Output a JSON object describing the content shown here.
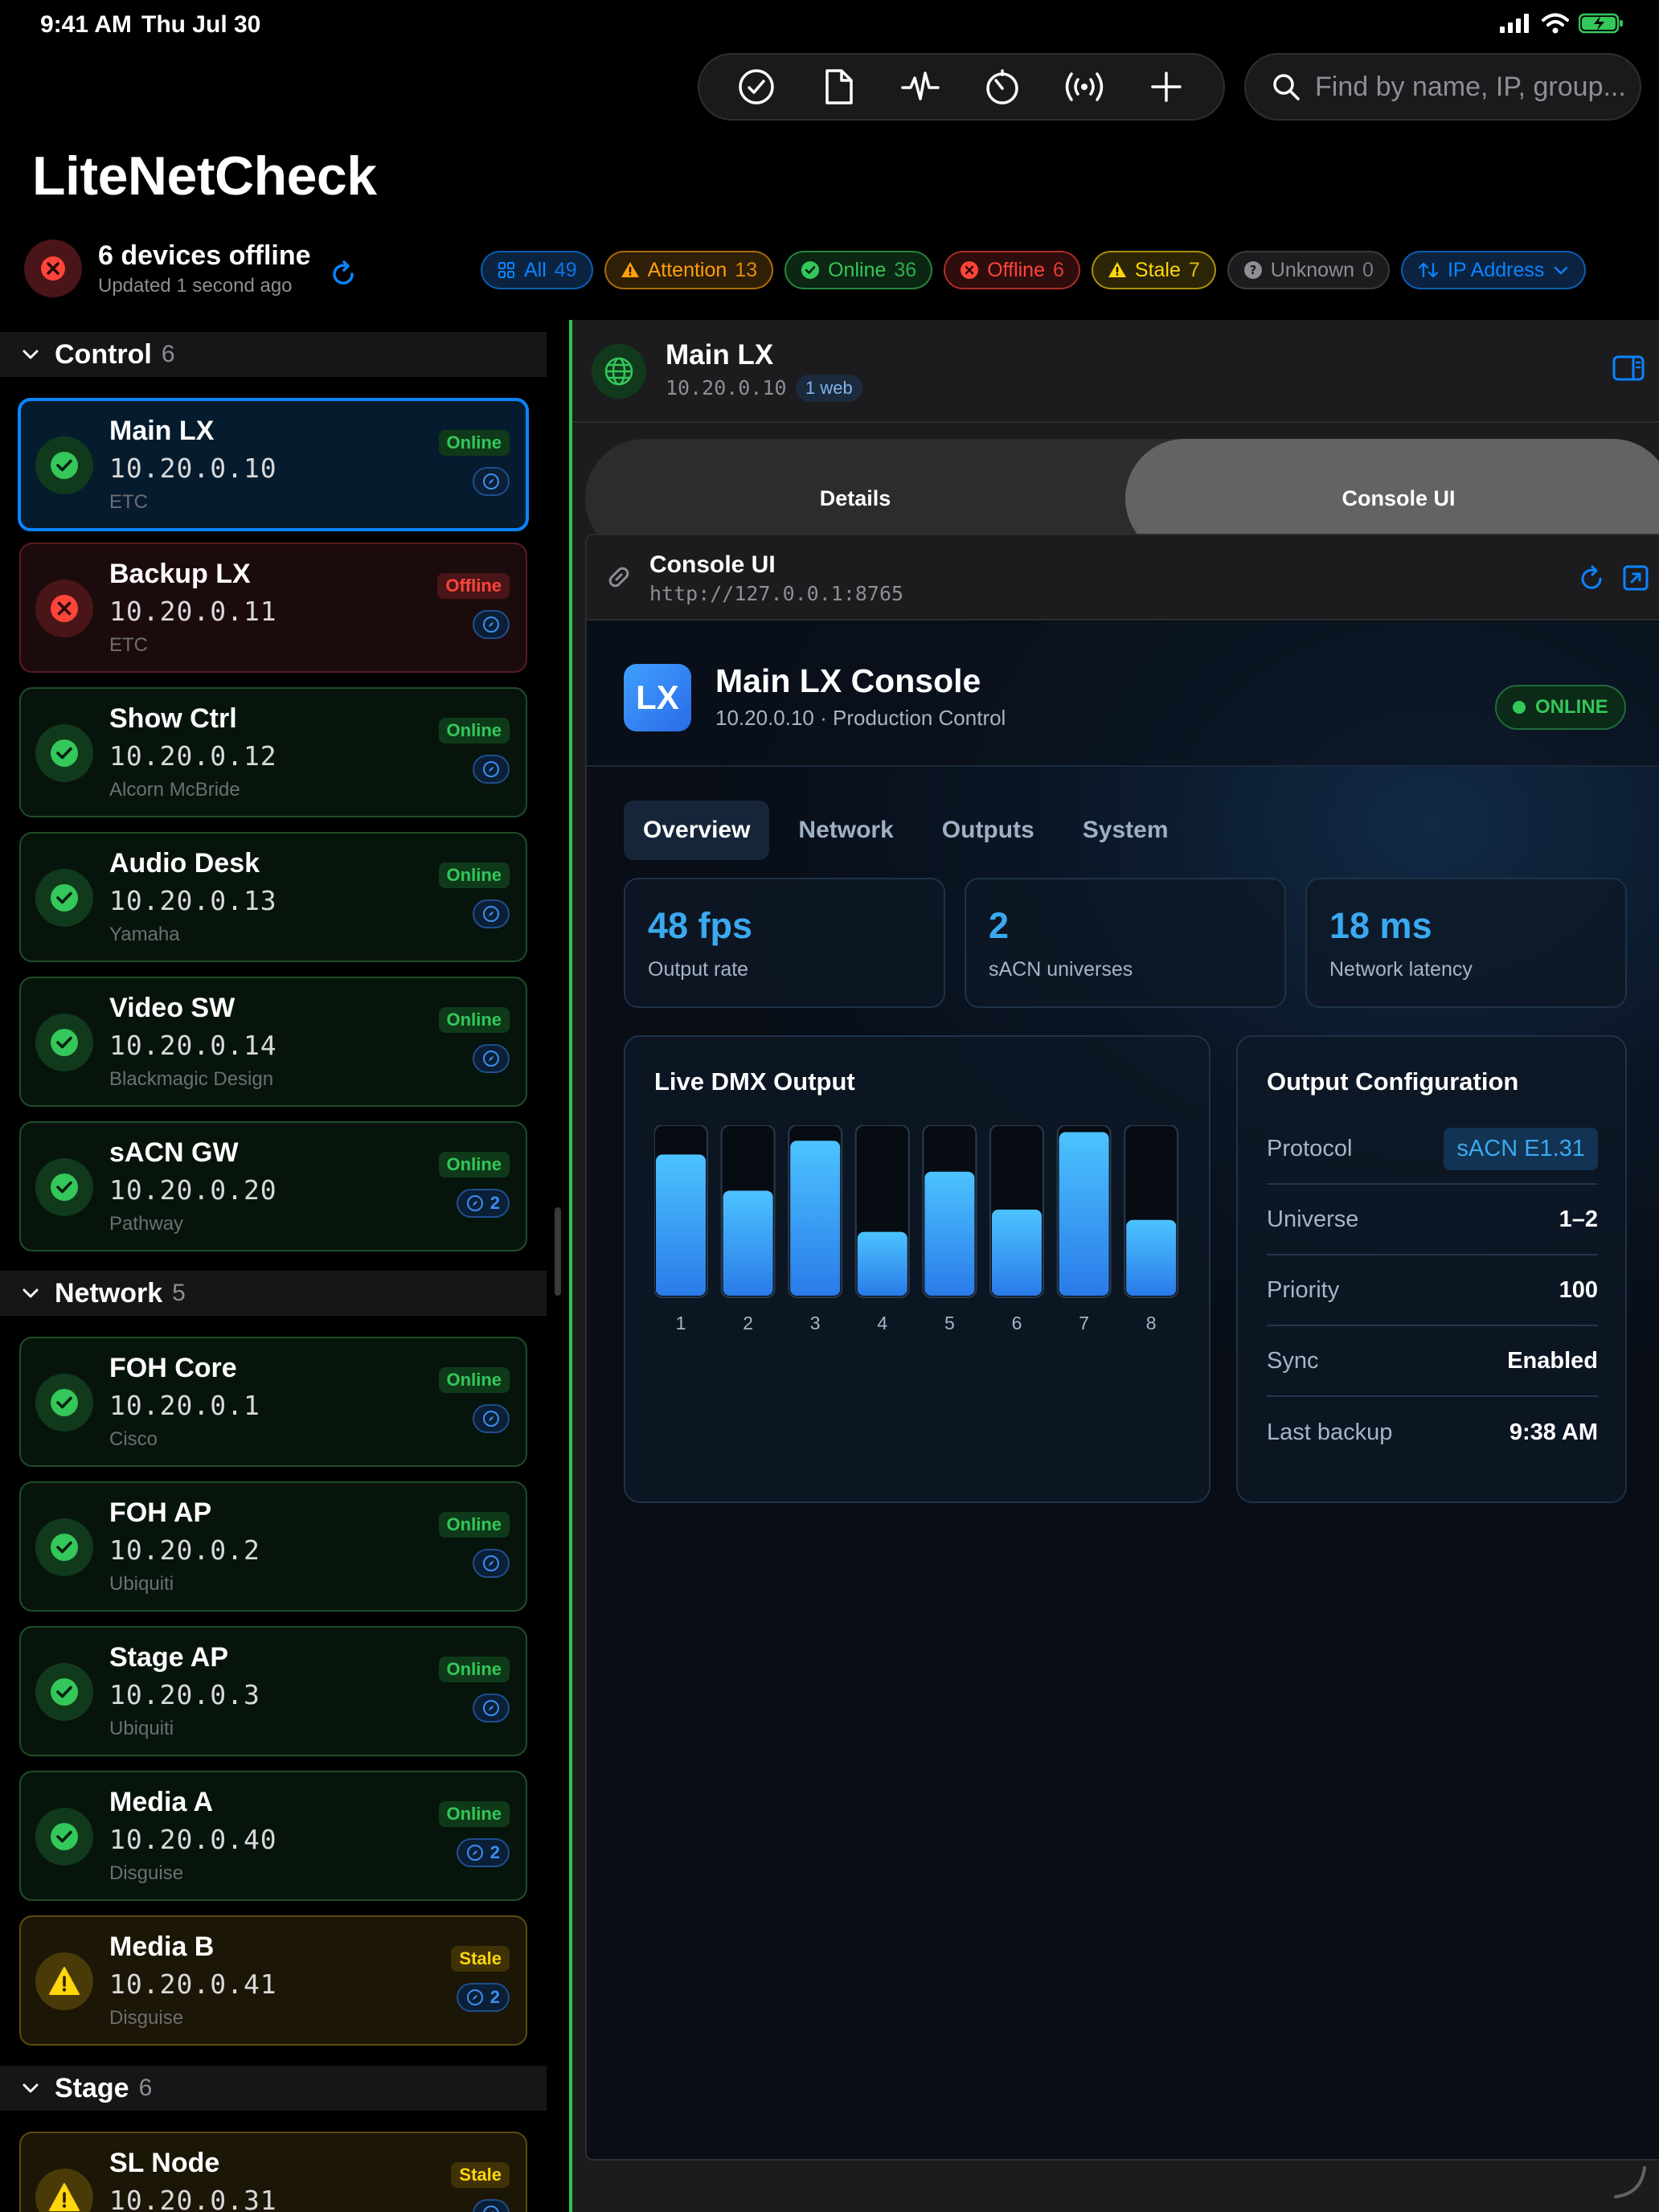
{
  "status_bar": {
    "time": "9:41 AM",
    "date": "Thu Jul 30"
  },
  "toolbar": {
    "buttons": [
      "checkmark-circle-icon",
      "document-icon",
      "waveform-icon",
      "timer-icon",
      "broadcast-icon",
      "plus-icon"
    ],
    "search_placeholder": "Find by name, IP, group..."
  },
  "app": {
    "title": "LiteNetCheck"
  },
  "summary": {
    "title": "6 devices offline",
    "subtitle": "Updated 1 second ago"
  },
  "filters": [
    {
      "label": "All",
      "count": "49",
      "icon": "grid-icon",
      "color": "#0a84ff"
    },
    {
      "label": "Attention",
      "count": "13",
      "icon": "warning-icon",
      "color": "#ff9f0a"
    },
    {
      "label": "Online",
      "count": "36",
      "icon": "check-icon",
      "color": "#34c759"
    },
    {
      "label": "Offline",
      "count": "6",
      "icon": "x-icon",
      "color": "#ff453a"
    },
    {
      "label": "Stale",
      "count": "7",
      "icon": "warning-icon",
      "color": "#ffd60a"
    },
    {
      "label": "Unknown",
      "count": "0",
      "icon": "question-icon",
      "color": "#8e8e93"
    },
    {
      "label": "IP Address",
      "count": "",
      "icon": "sort-icon",
      "color": "#0a84ff"
    }
  ],
  "sidebar": {
    "sections": [
      {
        "title": "Control",
        "count": "6"
      },
      {
        "title": "Network",
        "count": "5"
      },
      {
        "title": "Stage",
        "count": "6"
      }
    ],
    "devices": [
      {
        "name": "Main LX",
        "ip": "10.20.0.10",
        "vendor": "ETC",
        "status": "Online",
        "web": ""
      },
      {
        "name": "Backup LX",
        "ip": "10.20.0.11",
        "vendor": "ETC",
        "status": "Offline",
        "web": ""
      },
      {
        "name": "Show Ctrl",
        "ip": "10.20.0.12",
        "vendor": "Alcorn McBride",
        "status": "Online",
        "web": ""
      },
      {
        "name": "Audio Desk",
        "ip": "10.20.0.13",
        "vendor": "Yamaha",
        "status": "Online",
        "web": ""
      },
      {
        "name": "Video SW",
        "ip": "10.20.0.14",
        "vendor": "Blackmagic Design",
        "status": "Online",
        "web": ""
      },
      {
        "name": "sACN GW",
        "ip": "10.20.0.20",
        "vendor": "Pathway",
        "status": "Online",
        "web": "2"
      },
      {
        "name": "FOH Core",
        "ip": "10.20.0.1",
        "vendor": "Cisco",
        "status": "Online",
        "web": ""
      },
      {
        "name": "FOH AP",
        "ip": "10.20.0.2",
        "vendor": "Ubiquiti",
        "status": "Online",
        "web": ""
      },
      {
        "name": "Stage AP",
        "ip": "10.20.0.3",
        "vendor": "Ubiquiti",
        "status": "Online",
        "web": ""
      },
      {
        "name": "Media A",
        "ip": "10.20.0.40",
        "vendor": "Disguise",
        "status": "Online",
        "web": "2"
      },
      {
        "name": "Media B",
        "ip": "10.20.0.41",
        "vendor": "Disguise",
        "status": "Stale",
        "web": "2"
      },
      {
        "name": "SL Node",
        "ip": "10.20.0.31",
        "vendor": "",
        "status": "Stale",
        "web": ""
      }
    ]
  },
  "detail": {
    "name": "Main LX",
    "ip": "10.20.0.10",
    "web_count": "1 web",
    "tabs": [
      "Details",
      "Console UI"
    ],
    "selected_tab": "Console UI",
    "console": {
      "title": "Console UI",
      "url": "http://127.0.0.1:8765"
    }
  },
  "web": {
    "logo": "LX",
    "title": "Main LX Console",
    "subtitle": "10.20.0.10 · Production Control",
    "status": "ONLINE",
    "tabs": [
      "Overview",
      "Network",
      "Outputs",
      "System"
    ],
    "active_tab": "Overview",
    "stats": [
      {
        "value": "48 fps",
        "label": "Output rate"
      },
      {
        "value": "2",
        "label": "sACN universes"
      },
      {
        "value": "18 ms",
        "label": "Network latency"
      }
    ],
    "dmx": {
      "title": "Live DMX Output",
      "channels": [
        "1",
        "2",
        "3",
        "4",
        "5",
        "6",
        "7",
        "8"
      ],
      "levels": [
        0.83,
        0.62,
        0.91,
        0.38,
        0.73,
        0.51,
        0.96,
        0.45
      ]
    },
    "config": {
      "title": "Output Configuration",
      "rows": [
        {
          "key": "Protocol",
          "value": "sACN E1.31"
        },
        {
          "key": "Universe",
          "value": "1–2"
        },
        {
          "key": "Priority",
          "value": "100"
        },
        {
          "key": "Sync",
          "value": "Enabled"
        },
        {
          "key": "Last backup",
          "value": "9:38 AM"
        }
      ]
    }
  },
  "colors": {
    "accent": "#0a84ff",
    "online": "#34c759",
    "offline": "#ff453a",
    "stale": "#ffd60a",
    "divider": "#2dc653"
  }
}
